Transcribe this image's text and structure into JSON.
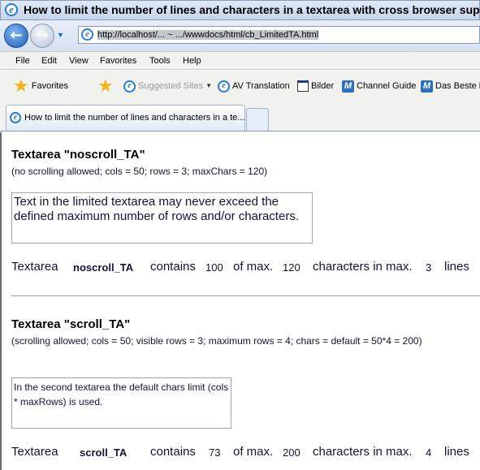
{
  "window": {
    "title": "How to limit the number of lines and characters in a textarea with cross browser support? -"
  },
  "address": {
    "url": "http://localhost/... ~ .../wwwdocs/html/cb_LimitedTA.html"
  },
  "menu": [
    "File",
    "Edit",
    "View",
    "Favorites",
    "Tools",
    "Help"
  ],
  "favorites_bar": {
    "favorites": "Favorites",
    "items": [
      "Suggested Sites",
      "AV Translation",
      "Bilder",
      "Channel Guide",
      "Das Beste i"
    ]
  },
  "tab": {
    "title": "How to limit the number of lines and characters in a te..."
  },
  "section1": {
    "heading": "Textarea \"noscroll_TA\"",
    "subtitle": "(no scrolling allowed; cols = 50; rows = 3; maxChars = 120)",
    "textarea_value": "Text in the limited textarea may never exceed the defined maximum number of rows and/or characters.",
    "status": {
      "label": "Textarea",
      "name": "noscroll_TA",
      "contains": "contains",
      "count": "100",
      "of_max": "of max.",
      "max_chars": "120",
      "chars_in_max": "characters in max.",
      "max_lines": "3",
      "lines": "lines"
    }
  },
  "section2": {
    "heading": "Textarea \"scroll_TA\"",
    "subtitle": "(scrolling allowed; cols = 50; visible rows = 3; maximum rows = 4; chars = default = 50*4 = 200)",
    "textarea_value": "In the second textarea the default chars limit (cols * maxRows) is used.",
    "status": {
      "label": "Textarea",
      "name": "scroll_TA",
      "contains": "contains",
      "count": "73",
      "of_max": "of max.",
      "max_chars": "200",
      "chars_in_max": "characters in max.",
      "max_lines": "4",
      "lines": "lines"
    }
  }
}
